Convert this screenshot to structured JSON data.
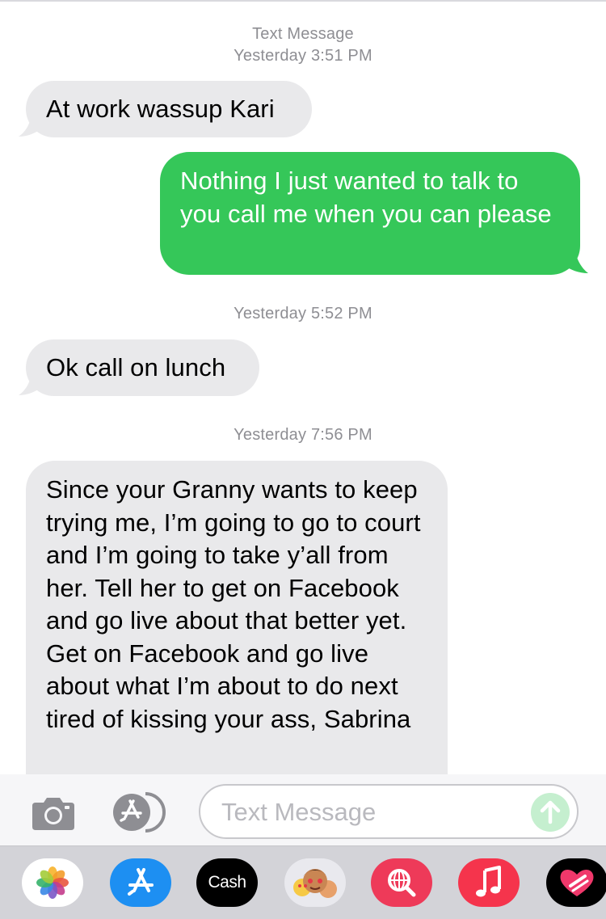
{
  "thread": {
    "header_label": "Text Message",
    "timestamps": [
      "Yesterday 3:51 PM",
      "Yesterday 5:52 PM",
      "Yesterday 7:56 PM"
    ],
    "messages": [
      {
        "direction": "incoming",
        "text": "At work wassup Kari"
      },
      {
        "direction": "outgoing",
        "text": "Nothing I just wanted to talk to you call me when you can please"
      },
      {
        "direction": "incoming",
        "text": "Ok call on lunch"
      },
      {
        "direction": "incoming",
        "text": "Since your Granny wants to keep trying me, I’m going to go to court and I’m going to take y’all from her. Tell her to get on Facebook and go live about that better yet. Get on Facebook and go live about what I’m about to do next tired of kissing your ass, Sabrina"
      }
    ]
  },
  "composer": {
    "placeholder": "Text Message",
    "camera_icon": "camera-icon",
    "apps_icon": "app-store-icon",
    "send_icon": "send-arrow-icon"
  },
  "drawer": {
    "apps": [
      {
        "name": "Photos",
        "icon": "photos-icon"
      },
      {
        "name": "App Store",
        "icon": "app-store-icon"
      },
      {
        "name": "Cash",
        "label": "Cash",
        "icon": "cash-app-icon"
      },
      {
        "name": "Memoji",
        "icon": "memoji-icon"
      },
      {
        "name": "Images",
        "icon": "image-search-icon"
      },
      {
        "name": "Music",
        "icon": "music-icon"
      },
      {
        "name": "Digital Touch",
        "icon": "digital-touch-icon"
      }
    ]
  },
  "colors": {
    "incoming_bubble": "#e9e9eb",
    "outgoing_bubble": "#35c759",
    "timestamp_text": "#8e8e93",
    "composer_background": "#f6f6f8",
    "drawer_background": "#d3d3d8",
    "send_button_disabled": "#c5efcf"
  }
}
